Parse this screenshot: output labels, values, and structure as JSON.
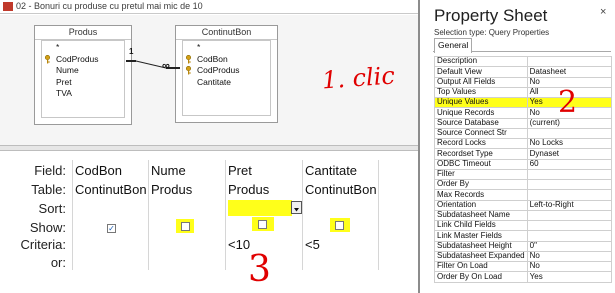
{
  "window": {
    "title": "02 - Bonuri cu produse cu pretul mai mic de 10"
  },
  "tables": {
    "produs": {
      "name": "Produs",
      "fields": [
        "*",
        "CodProdus",
        "Nume",
        "Pret",
        "TVA"
      ]
    },
    "continutbon": {
      "name": "ContinutBon",
      "fields": [
        "*",
        "CodBon",
        "CodProdus",
        "Cantitate"
      ]
    }
  },
  "relationship": {
    "one_label": "1",
    "many_label": "∞"
  },
  "grid": {
    "row_labels": {
      "field": "Field:",
      "table": "Table:",
      "sort": "Sort:",
      "show": "Show:",
      "criteria": "Criteria:",
      "or": "or:"
    },
    "columns": [
      {
        "field": "CodBon",
        "table": "ContinutBon",
        "show": true,
        "criteria": ""
      },
      {
        "field": "Nume",
        "table": "Produs",
        "show": false,
        "criteria": ""
      },
      {
        "field": "Pret",
        "table": "Produs",
        "show": false,
        "criteria": "<10"
      },
      {
        "field": "Cantitate",
        "table": "ContinutBon",
        "show": false,
        "criteria": "<5"
      }
    ]
  },
  "annotations": {
    "step1": "1. clic",
    "step2": "2",
    "step3": "3"
  },
  "colors": {
    "highlight": "#ffff1a",
    "annotation": "#e00000"
  },
  "property_sheet": {
    "title": "Property Sheet",
    "close_glyph": "×",
    "selection_type": "Selection type:  Query Properties",
    "tab": "General",
    "highlighted": "Unique Values",
    "properties": [
      {
        "name": "Description",
        "value": ""
      },
      {
        "name": "Default View",
        "value": "Datasheet"
      },
      {
        "name": "Output All Fields",
        "value": "No"
      },
      {
        "name": "Top Values",
        "value": "All"
      },
      {
        "name": "Unique Values",
        "value": "Yes"
      },
      {
        "name": "Unique Records",
        "value": "No"
      },
      {
        "name": "Source Database",
        "value": "(current)"
      },
      {
        "name": "Source Connect Str",
        "value": ""
      },
      {
        "name": "Record Locks",
        "value": "No Locks"
      },
      {
        "name": "Recordset Type",
        "value": "Dynaset"
      },
      {
        "name": "ODBC Timeout",
        "value": "60"
      },
      {
        "name": "Filter",
        "value": ""
      },
      {
        "name": "Order By",
        "value": ""
      },
      {
        "name": "Max Records",
        "value": ""
      },
      {
        "name": "Orientation",
        "value": "Left-to-Right"
      },
      {
        "name": "Subdatasheet Name",
        "value": ""
      },
      {
        "name": "Link Child Fields",
        "value": ""
      },
      {
        "name": "Link Master Fields",
        "value": ""
      },
      {
        "name": "Subdatasheet Height",
        "value": "0\""
      },
      {
        "name": "Subdatasheet Expanded",
        "value": "No"
      },
      {
        "name": "Filter On Load",
        "value": "No"
      },
      {
        "name": "Order By On Load",
        "value": "Yes"
      }
    ]
  }
}
